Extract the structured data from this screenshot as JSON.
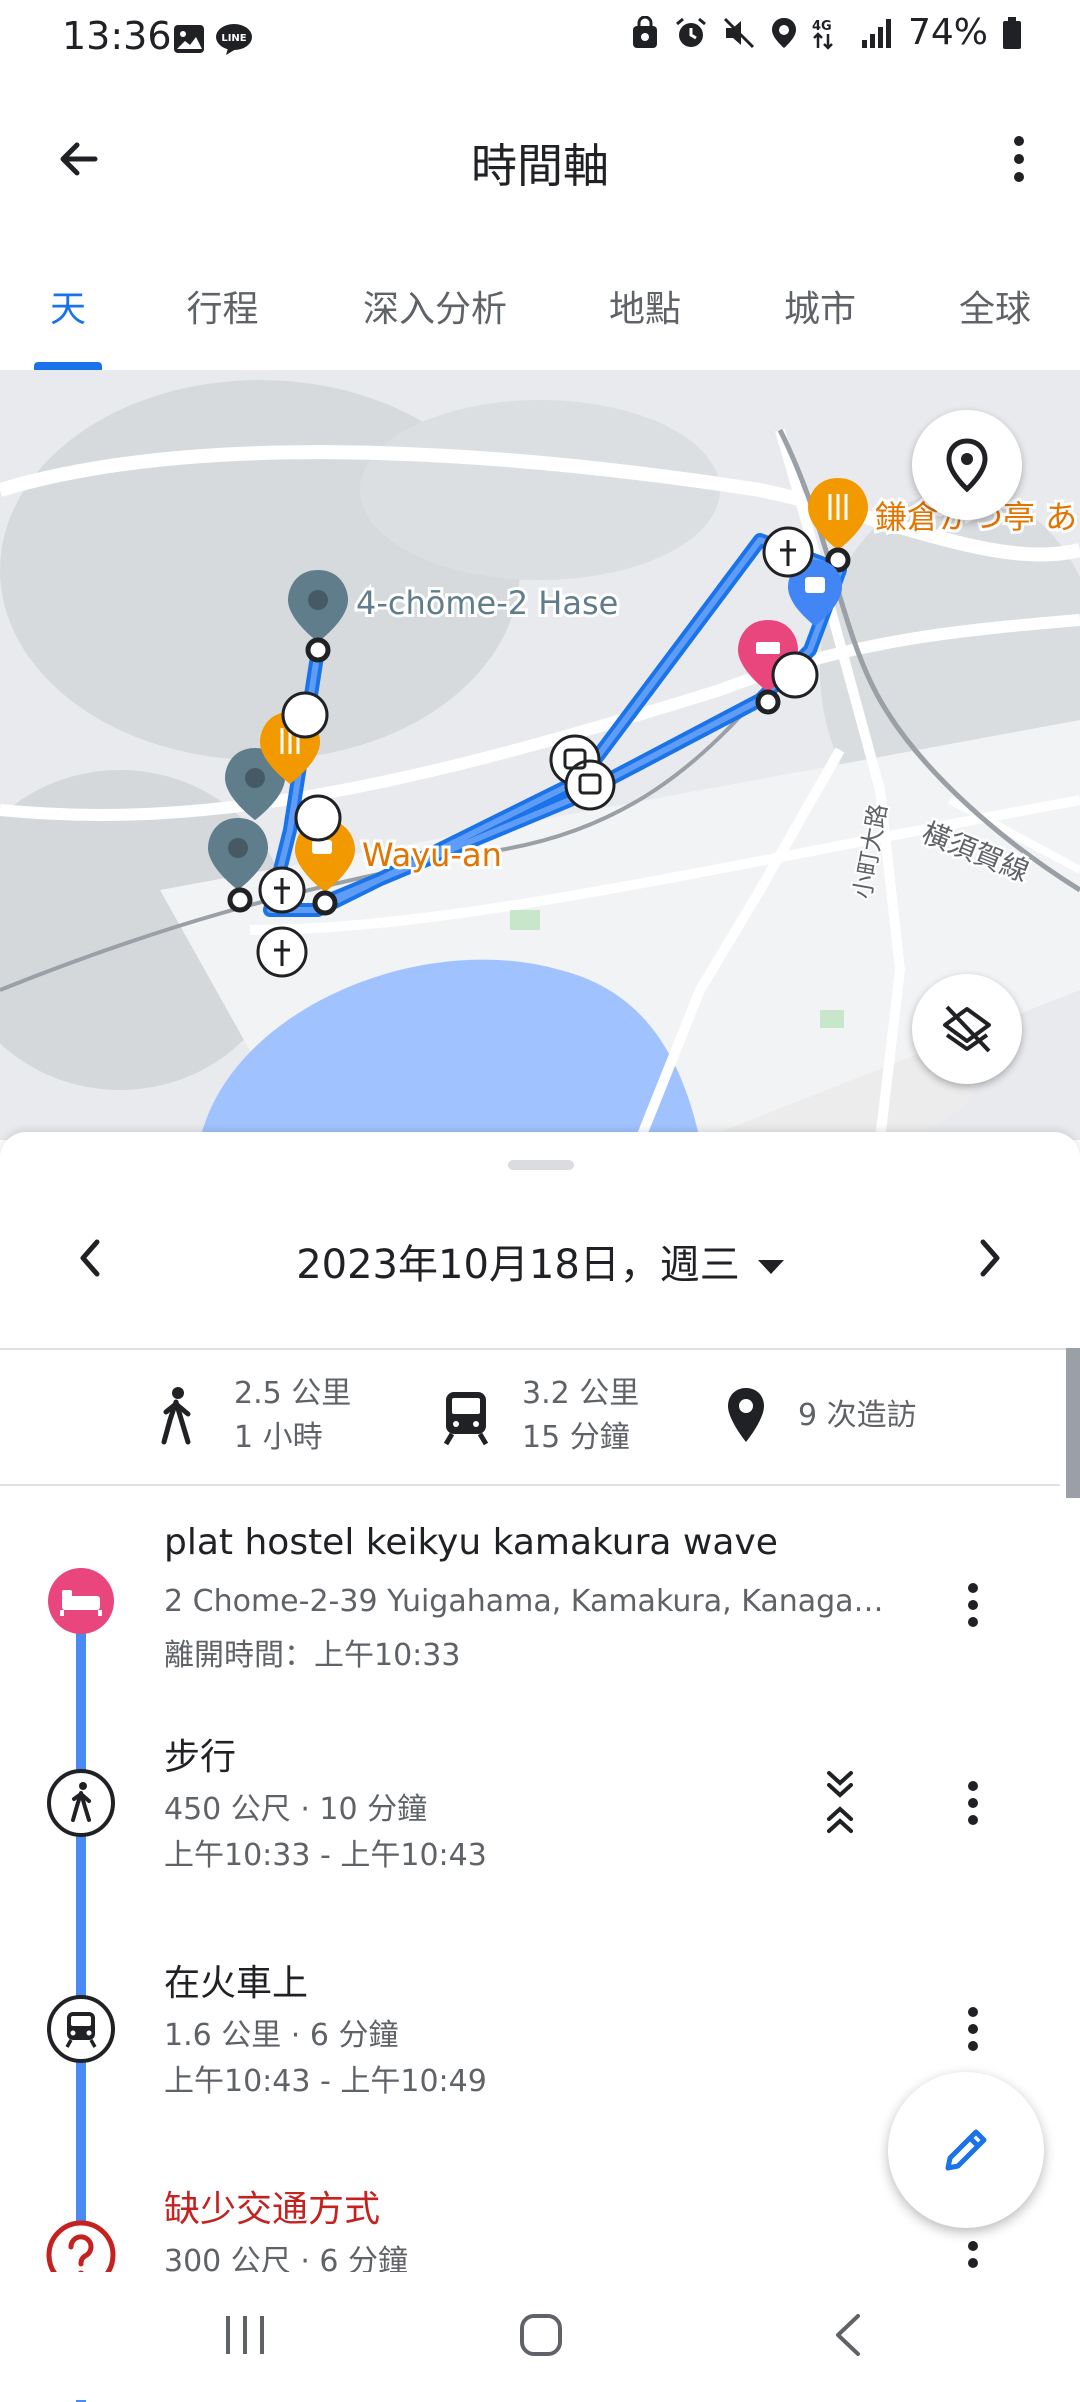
{
  "status": {
    "time": "13:36",
    "battery": "74%",
    "network": "4G"
  },
  "app_bar": {
    "title": "時間軸"
  },
  "tabs": [
    {
      "label": "天",
      "active": true
    },
    {
      "label": "行程",
      "active": false
    },
    {
      "label": "深入分析",
      "active": false
    },
    {
      "label": "地點",
      "active": false
    },
    {
      "label": "城市",
      "active": false
    },
    {
      "label": "全球",
      "active": false
    }
  ],
  "map": {
    "labels": {
      "hase": "4-chōme-2 Hase",
      "wayuan": "Wayu-an",
      "restaurant": "鎌倉かつ亭 あ",
      "yokosuka_line": "橫須賀線",
      "komachi": "小町大路"
    },
    "colors": {
      "route": "#1a73e8",
      "food": "#f29900",
      "hotel": "#e8467c",
      "shop": "#4285f4",
      "place": "#607d8b",
      "water": "#a0c3ff"
    }
  },
  "day": {
    "date": "2023年10月18日，週三"
  },
  "summary": {
    "walk_distance": "2.5 公里",
    "walk_time": "1 小時",
    "train_distance": "3.2 公里",
    "train_time": "15 分鐘",
    "visits": "9 次造訪"
  },
  "timeline": [
    {
      "type": "place",
      "icon": "hotel-icon",
      "title": "plat hostel keikyu kamakura wave",
      "line1": "2 Chome-2-39 Yuigahama, Kamakura, Kanaga…",
      "line2": "離開時間：上午10:33"
    },
    {
      "type": "walk",
      "icon": "walking-icon",
      "title": "步行",
      "line1": "450 公尺 · 10 分鐘",
      "line2": "上午10:33 - 上午10:43"
    },
    {
      "type": "train",
      "icon": "train-icon",
      "title": "在火車上",
      "line1": "1.6 公里 · 6 分鐘",
      "line2": "上午10:43 - 上午10:49"
    },
    {
      "type": "missing",
      "icon": "question-icon",
      "title": "缺少交通方式",
      "line1": "300 公尺 · 6 分鐘"
    }
  ]
}
